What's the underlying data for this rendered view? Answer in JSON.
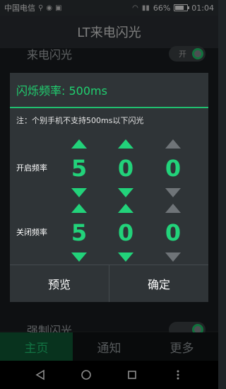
{
  "status": {
    "carrier": "中国电信",
    "battery": "66%",
    "time": "01:04"
  },
  "app_bar": {
    "title": "LT来电闪光"
  },
  "background": {
    "row1_label": "来电闪光",
    "row1_toggle": "开",
    "row2_label": "强制闪光"
  },
  "tabs": [
    "主页",
    "通知",
    "更多"
  ],
  "dialog": {
    "title": "闪烁频率: 500ms",
    "note": "注：个别手机不支持500ms以下闪光",
    "on_label": "开启频率",
    "off_label": "关闭频率",
    "on_digits": [
      "5",
      "0",
      "0"
    ],
    "off_digits": [
      "5",
      "0",
      "0"
    ],
    "preview_label": "预览",
    "confirm_label": "确定"
  }
}
